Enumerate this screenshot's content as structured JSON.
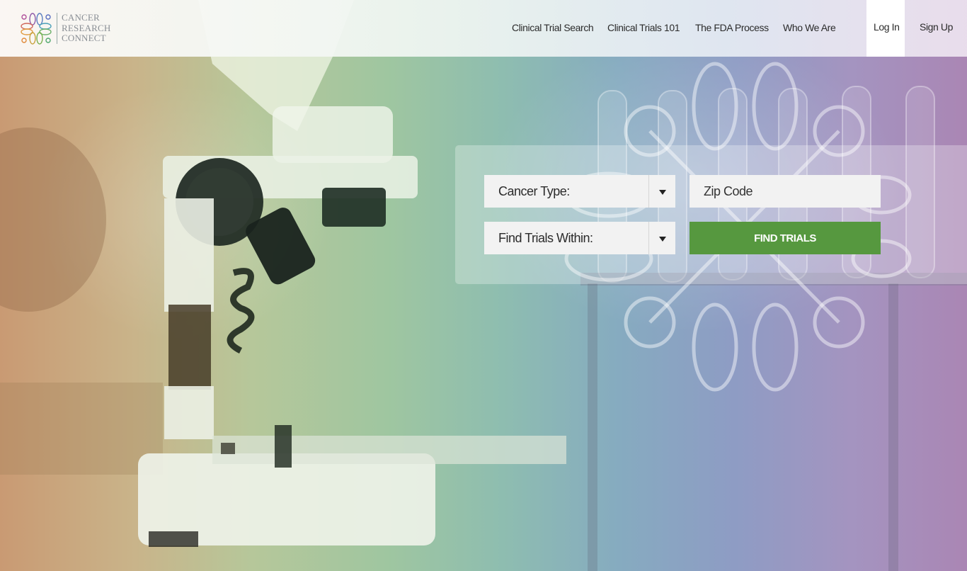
{
  "brand": {
    "name_line1": "CANCER",
    "name_line2": "RESEARCH",
    "name_line3": "CONNECT"
  },
  "nav": {
    "items": [
      {
        "label": "Clinical Trial Search"
      },
      {
        "label": "Clinical Trials 101"
      },
      {
        "label": "The FDA Process"
      },
      {
        "label": "Who We Are"
      }
    ],
    "login_label": "Log In",
    "signup_label": "Sign Up"
  },
  "search": {
    "cancer_type_label": "Cancer Type:",
    "zip_placeholder": "Zip Code",
    "distance_label": "Find Trials Within:",
    "submit_label": "FIND TRIALS"
  },
  "colors": {
    "accent_green": "#56983f",
    "gradient_left": "#c99a73",
    "gradient_right": "#aa86b4"
  },
  "icons": {
    "logo": "ribbon-knot-logo-icon",
    "dropdown": "caret-down-icon",
    "watermark": "ribbon-knot-watermark-icon"
  }
}
